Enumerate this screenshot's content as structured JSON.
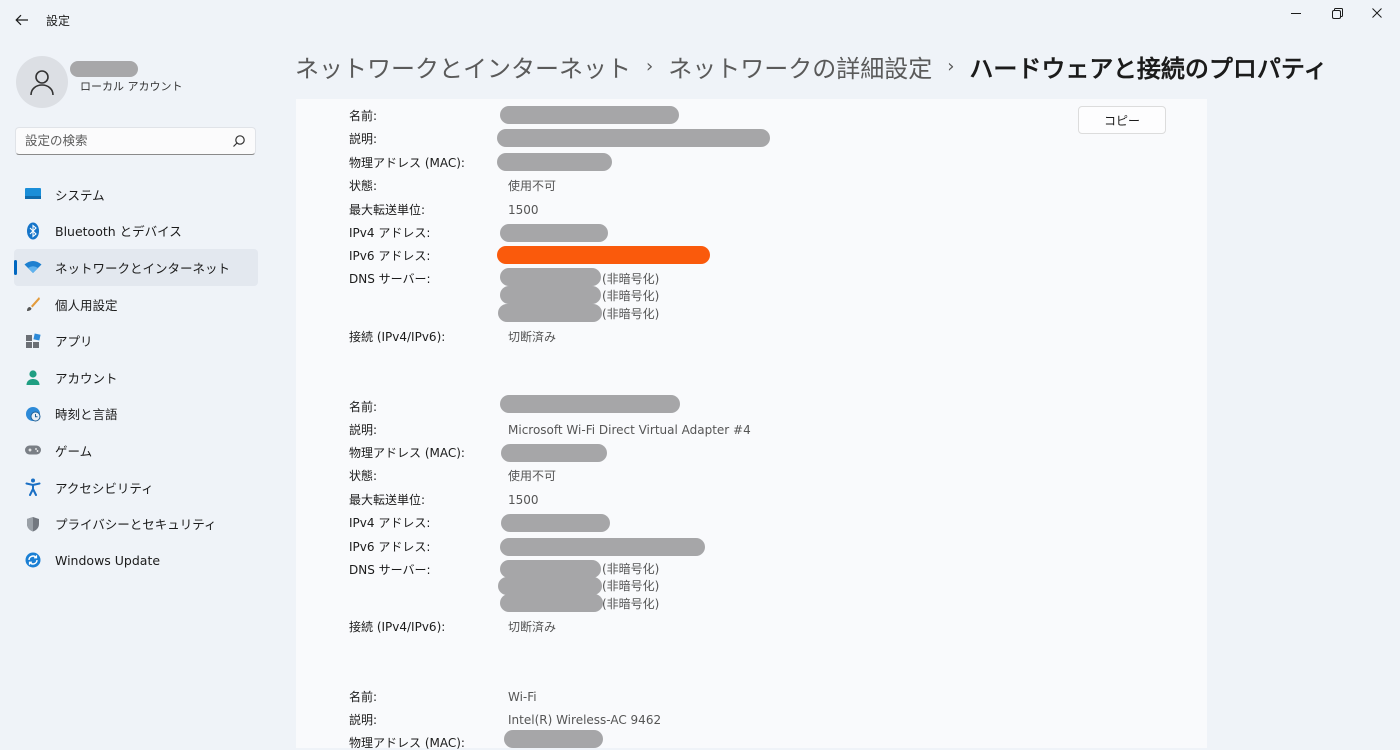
{
  "window": {
    "title": "設定"
  },
  "user": {
    "account_type": "ローカル アカウント"
  },
  "search": {
    "placeholder": "設定の検索"
  },
  "sidebar": {
    "items": [
      {
        "label": "システム",
        "icon": "system-icon"
      },
      {
        "label": "Bluetooth とデバイス",
        "icon": "bluetooth-icon"
      },
      {
        "label": "ネットワークとインターネット",
        "icon": "wifi-icon",
        "active": true
      },
      {
        "label": "個人用設定",
        "icon": "brush-icon"
      },
      {
        "label": "アプリ",
        "icon": "apps-icon"
      },
      {
        "label": "アカウント",
        "icon": "person-icon"
      },
      {
        "label": "時刻と言語",
        "icon": "globe-clock-icon"
      },
      {
        "label": "ゲーム",
        "icon": "gamepad-icon"
      },
      {
        "label": "アクセシビリティ",
        "icon": "accessibility-icon"
      },
      {
        "label": "プライバシーとセキュリティ",
        "icon": "shield-icon"
      },
      {
        "label": "Windows Update",
        "icon": "update-icon"
      }
    ]
  },
  "breadcrumb": {
    "level1": "ネットワークとインターネット",
    "level2": "ネットワークの詳細設定",
    "current": "ハードウェアと接続のプロパティ",
    "separator": "›"
  },
  "copy_button": "コピー",
  "adapters": [
    {
      "labels": {
        "name": "名前:",
        "description": "説明:",
        "mac": "物理アドレス (MAC):",
        "status": "状態:",
        "mtu": "最大転送単位:",
        "ipv4": "IPv4 アドレス:",
        "ipv6": "IPv6 アドレス:",
        "dns": "DNS サーバー:",
        "connectivity": "接続 (IPv4/IPv6):"
      },
      "status": "使用不可",
      "mtu": "1500",
      "dns_suffix": [
        "(非暗号化)",
        "(非暗号化)",
        "(非暗号化)"
      ],
      "connectivity": "切断済み"
    },
    {
      "labels": {
        "name": "名前:",
        "description": "説明:",
        "mac": "物理アドレス (MAC):",
        "status": "状態:",
        "mtu": "最大転送単位:",
        "ipv4": "IPv4 アドレス:",
        "ipv6": "IPv6 アドレス:",
        "dns": "DNS サーバー:",
        "connectivity": "接続 (IPv4/IPv6):"
      },
      "description": "Microsoft Wi-Fi Direct Virtual Adapter #4",
      "status": "使用不可",
      "mtu": "1500",
      "dns_suffix": [
        "(非暗号化)",
        "(非暗号化)",
        "(非暗号化)"
      ],
      "connectivity": "切断済み"
    },
    {
      "labels": {
        "name": "名前:",
        "description": "説明:",
        "mac": "物理アドレス (MAC):"
      },
      "name": "Wi-Fi",
      "description": "Intel(R) Wireless-AC 9462"
    }
  ],
  "colors": {
    "accent": "#0067c0",
    "redaction": "#a6a6a8",
    "highlight": "#fa5a0c"
  }
}
